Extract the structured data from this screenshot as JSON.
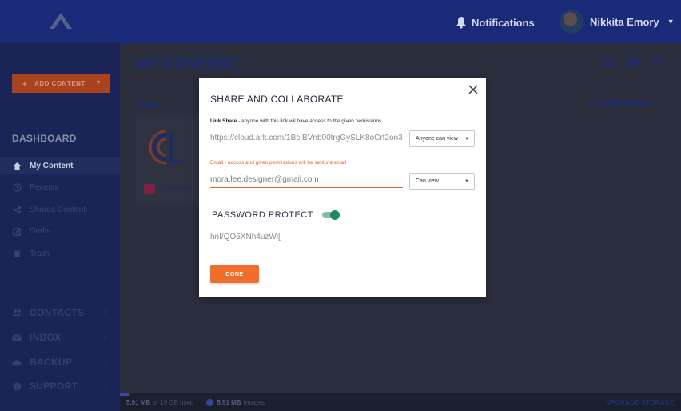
{
  "header": {
    "notifications_label": "Notifications",
    "user_name": "Nikkita Emory"
  },
  "sidebar": {
    "add_content_label": "ADD CONTENT",
    "section_title": "DASHBOARD",
    "items": [
      {
        "label": "My Content",
        "icon": "home-icon",
        "active": true
      },
      {
        "label": "Recents",
        "icon": "clock-icon",
        "active": false
      },
      {
        "label": "Shared Content",
        "icon": "share-icon",
        "active": false
      },
      {
        "label": "Drafts",
        "icon": "edit-icon",
        "active": false
      },
      {
        "label": "Trash",
        "icon": "trash-icon",
        "active": false
      }
    ],
    "groups": [
      {
        "label": "CONTACTS",
        "icon": "people-icon"
      },
      {
        "label": "INBOX",
        "icon": "mail-icon"
      },
      {
        "label": "BACKUP",
        "icon": "cloud-icon"
      },
      {
        "label": "SUPPORT",
        "icon": "help-icon"
      }
    ]
  },
  "main": {
    "page_title": "MY CONTENT",
    "files_label": "Files",
    "sort_label": "DATE ADDED",
    "file_name": "Craigs...logo"
  },
  "status_bar": {
    "used_value": "5.91 MB",
    "used_suffix": "of 10 GB used",
    "images_value": "5.91 MB",
    "images_suffix": "Images",
    "upgrade_label": "UPGRADE STORAGE"
  },
  "modal": {
    "title": "SHARE AND COLLABORATE",
    "link_share_label_bold": "Link Share",
    "link_share_label_rest": " - anyone with this link wil have access to the given pemissions",
    "link_value": "https://cloud.ark.com/1BcIBVnb00trgGySLK8oCrf2on3",
    "link_permission": "Anyone can view",
    "email_label": "Email - access and given permissions will be sent via email",
    "email_value": "mora.lee.designer@gmail.com",
    "email_permission": "Can view",
    "password_protect_label": "PASSWORD PROTECT",
    "password_protect_on": true,
    "password_value": "hnI/QO5XNh4uzWi[",
    "done_label": "DONE"
  },
  "colors": {
    "accent": "#f06d2b",
    "toggle_on": "#1e8a6a",
    "brand_navy": "#1b2a78"
  }
}
